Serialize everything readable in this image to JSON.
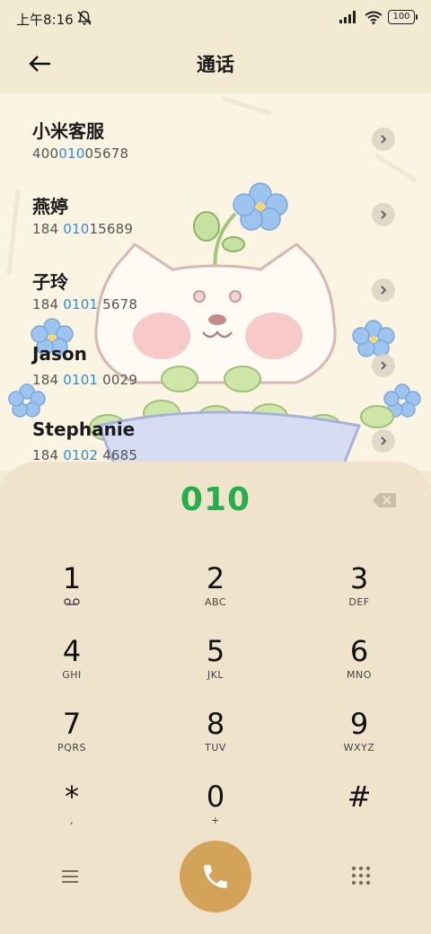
{
  "status": {
    "time": "上午8:16",
    "battery": "100"
  },
  "header": {
    "title": "通话"
  },
  "contacts": [
    {
      "name": "小米客服",
      "pre": "400",
      "hl": "010",
      "post": "05678"
    },
    {
      "name": "燕婷",
      "pre": "184 ",
      "hl": "010",
      "post": "15689"
    },
    {
      "name": "子玲",
      "pre": "184 ",
      "hl": "0101",
      "post": " 5678"
    },
    {
      "name": "Jason",
      "pre": "184 ",
      "hl": "0101",
      "post": " 0029"
    },
    {
      "name": "Stephanie",
      "pre": "184 ",
      "hl": "0102",
      "post": " 4685"
    }
  ],
  "dialer": {
    "number": "010",
    "keys": [
      {
        "digit": "1",
        "letters": ""
      },
      {
        "digit": "2",
        "letters": "ABC"
      },
      {
        "digit": "3",
        "letters": "DEF"
      },
      {
        "digit": "4",
        "letters": "GHI"
      },
      {
        "digit": "5",
        "letters": "JKL"
      },
      {
        "digit": "6",
        "letters": "MNO"
      },
      {
        "digit": "7",
        "letters": "PQRS"
      },
      {
        "digit": "8",
        "letters": "TUV"
      },
      {
        "digit": "9",
        "letters": "WXYZ"
      },
      {
        "digit": "*",
        "letters": ","
      },
      {
        "digit": "0",
        "letters": "+"
      },
      {
        "digit": "#",
        "letters": ""
      }
    ]
  },
  "colors": {
    "accent_green": "#22b04a",
    "highlight_blue": "#2a8ee0",
    "call_button": "#d4a35a"
  },
  "icons": {
    "voicemail": "voicemail-icon",
    "backspace": "backspace-icon",
    "call": "phone-icon",
    "menu": "menu-icon",
    "dialpad": "dialpad-icon"
  }
}
